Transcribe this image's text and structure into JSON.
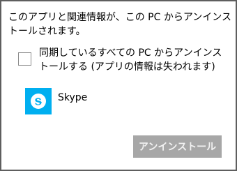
{
  "dialog": {
    "message": "このアプリと関連情報が、この PC からアンインス\nトールされます。",
    "option_label": "同期しているすべての PC からアンインス\nトールする (アプリの情報は失われます)",
    "option_checked": false,
    "app": {
      "name": "Skype",
      "icon": "skype-icon",
      "icon_color": "#00aff0"
    },
    "uninstall_label": "アンインストール",
    "button_color": "#a7a7a7"
  }
}
